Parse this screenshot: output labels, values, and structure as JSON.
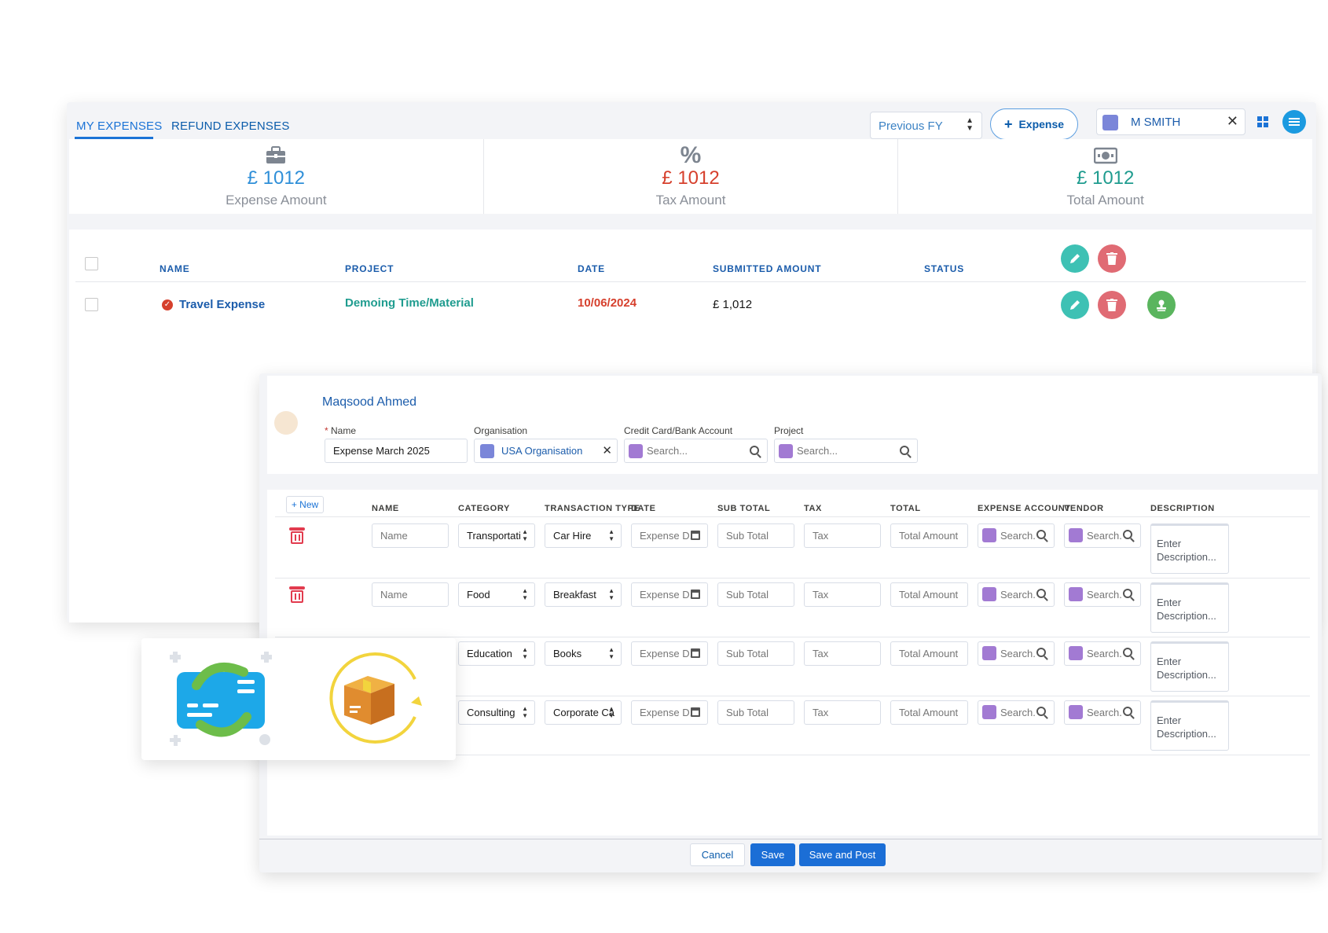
{
  "tabs": [
    {
      "label": "MY EXPENSES",
      "active": true
    },
    {
      "label": "REFUND EXPENSES",
      "active": false
    }
  ],
  "toolbar": {
    "fiscal_year": "Previous FY",
    "expense_button": "Expense",
    "user_filter": "M SMITH"
  },
  "stats": [
    {
      "icon": "briefcase-icon",
      "amount": "£ 1012",
      "label": "Expense Amount",
      "color": "#2f8fd8"
    },
    {
      "icon": "percent-icon",
      "amount": "£ 1012",
      "label": "Tax Amount",
      "color": "#d6402d"
    },
    {
      "icon": "money-icon",
      "amount": "£ 1012",
      "label": "Total Amount",
      "color": "#1f9c8f"
    }
  ],
  "list": {
    "headers": {
      "name": "NAME",
      "project": "PROJECT",
      "date": "DATE",
      "submitted": "SUBMITTED AMOUNT",
      "status": "STATUS"
    },
    "rows": [
      {
        "name": "Travel Expense",
        "project": "Demoing Time/Material",
        "date": "10/06/2024",
        "amount": "£ 1,012"
      }
    ]
  },
  "form": {
    "owner": "Maqsood Ahmed",
    "name_label": "Name",
    "name_value": "Expense March 2025",
    "org_label": "Organisation",
    "org_value": "USA Organisation",
    "cc_label": "Credit Card/Bank Account",
    "cc_placeholder": "Search...",
    "project_label": "Project",
    "project_placeholder": "Search..."
  },
  "lines": {
    "new_label": "+ New",
    "headers": {
      "name": "NAME",
      "category": "CATEGORY",
      "transaction_type": "TRANSACTION TYPE",
      "date": "DATE",
      "subtotal": "SUB TOTAL",
      "tax": "TAX",
      "total": "TOTAL",
      "expense_account": "EXPENSE ACCOUNT",
      "vendor": "VENDOR",
      "description": "DESCRIPTION"
    },
    "placeholders": {
      "name": "Name",
      "date": "Expense D.",
      "subtotal": "Sub Total",
      "tax": "Tax",
      "total": "Total Amount",
      "search": "Search.",
      "description": "Enter Description..."
    },
    "rows": [
      {
        "category": "Transportati",
        "type": "Car Hire"
      },
      {
        "category": "Food",
        "type": "Breakfast"
      },
      {
        "category": "Education",
        "type": "Books"
      },
      {
        "category": "Consulting",
        "type": "Corporate Ca"
      }
    ]
  },
  "footer": {
    "cancel": "Cancel",
    "save": "Save",
    "save_post": "Save and Post"
  },
  "colors": {
    "accent": "#1b73d6",
    "teal": "#3ec1b4",
    "danger": "#e06b74",
    "success": "#5ab55e"
  }
}
